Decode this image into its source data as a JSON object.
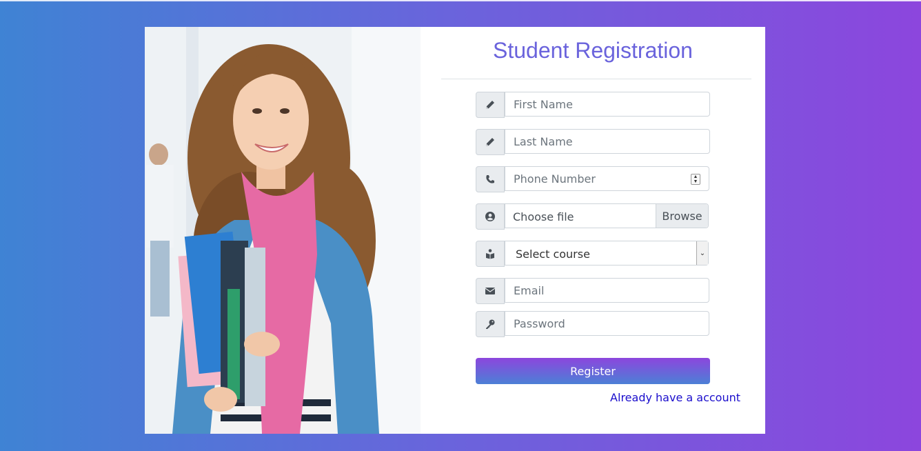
{
  "page": {
    "title": "Student Registration"
  },
  "form": {
    "first_name_placeholder": "First Name",
    "last_name_placeholder": "Last Name",
    "phone_placeholder": "Phone Number",
    "file_label": "Choose file",
    "browse_label": "Browse",
    "course_label": "Select course",
    "email_placeholder": "Email",
    "password_placeholder": "Password",
    "register_label": "Register",
    "login_link": "Already have a account"
  },
  "icons": {
    "first_name": "pencil-icon",
    "last_name": "pencil-icon",
    "phone": "phone-icon",
    "file": "user-circle-icon",
    "course": "reader-icon",
    "email": "envelope-icon",
    "password": "key-icon"
  },
  "colors": {
    "title": "#6a63dc",
    "gradient_start": "#3f83d4",
    "gradient_end": "#8c46dd",
    "link": "#1a0dcc"
  }
}
